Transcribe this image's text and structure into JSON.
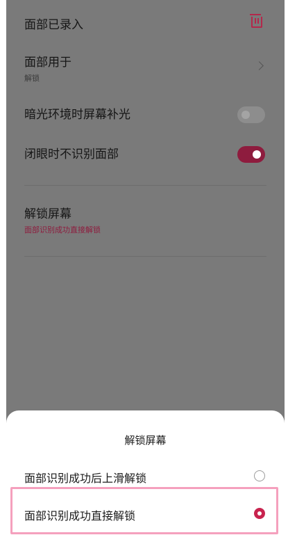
{
  "settings": {
    "face_enrolled": {
      "title": "面部已录入",
      "icon": "trash-icon"
    },
    "face_used_for": {
      "title": "面部用于",
      "value": "解锁",
      "icon": "chevron-right-icon"
    },
    "dim_light_fill": {
      "title": "暗光环境时屏幕补光",
      "state": "off"
    },
    "eyes_closed": {
      "title": "闭眼时不识别面部",
      "state": "on"
    },
    "unlock_screen": {
      "title": "解锁屏幕",
      "value": "面部识别成功直接解锁"
    }
  },
  "sheet": {
    "title": "解锁屏幕",
    "options": [
      {
        "label": "面部识别成功后上滑解锁",
        "selected": false
      },
      {
        "label": "面部识别成功直接解锁",
        "selected": true
      }
    ]
  },
  "colors": {
    "accent": "#8e1c3e",
    "radio_selected": "#c8234e",
    "highlight": "#f5a0bd",
    "overlay": "#7a7a7a"
  }
}
